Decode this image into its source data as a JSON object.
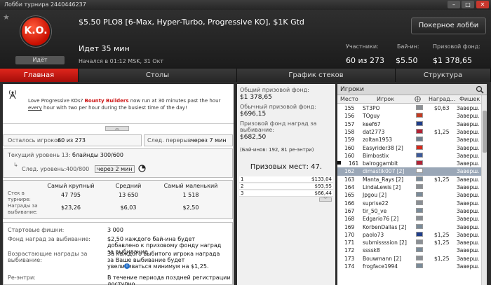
{
  "window": {
    "title": "Лобби турнира 2440446237"
  },
  "header": {
    "logo_text": "K.O.",
    "status": "Идёт",
    "tournament_name": "$5.50 PLO8 [6-Max, Hyper-Turbo, Progressive KO], $1K Gtd",
    "elapsed": "Идет 35 мин",
    "started": "Начался в 01:12 MSK, 31 Окт",
    "lobby_button": "Покерное лобби",
    "stats": [
      {
        "label": "Участники:",
        "value": "60 из 273"
      },
      {
        "label": "Бай-ин:",
        "value": "$5.50"
      },
      {
        "label": "Призовой фонд:",
        "value": "$1 378,65"
      }
    ]
  },
  "tabs": [
    "Главная",
    "Столы",
    "График стеков",
    "Структура"
  ],
  "promo": {
    "text_before": "Love Progressive KOs? ",
    "highlight": "Bounty Builders",
    "text_mid": " now run at 30 minutes past the hour ",
    "underline": "every",
    "text_after": " hour with two per hour during the busiest time of the day!"
  },
  "info": {
    "remaining_label": "Осталось игроков:",
    "remaining_value": "60 из 273",
    "break_label": "След. перерыв:",
    "break_value": "через 7 мин",
    "level_label": "Текущий уровень 13:",
    "level_value": "блайнды 300/600",
    "next_label": "След. уровень:",
    "next_value": "400/800",
    "next_time": "через 2 мин"
  },
  "stack_table": {
    "headers": [
      "Самый крупный",
      "Средний",
      "Самый маленький"
    ],
    "rows": [
      {
        "label": "Стек в турнире:",
        "values": [
          "47 795",
          "13 650",
          "1 518"
        ]
      },
      {
        "label": "Награды за выбивание:",
        "values": [
          "$23,26",
          "$6,03",
          "$2,50"
        ]
      }
    ]
  },
  "details": [
    {
      "label": "Стартовые фишки:",
      "value": "3 000"
    },
    {
      "label": "Фонд наград за выбивание:",
      "value": "$2,50 каждого бай-ина будет добавлено к призовому фонду наград за выбивание."
    },
    {
      "label": "Возрастающие награды за выбивание:",
      "value": "За каждого выбитого игрока награда за Ваше выбивание будет увеличиваться минимум на $1,25."
    },
    {
      "label": "Ре-энтри:",
      "value": "В течение периода поздней регистрации доступно"
    }
  ],
  "prize": {
    "total_label": "Общий призовой фонд:",
    "total_value": "$1 378,65",
    "regular_label": "Обычный призовой фонд:",
    "regular_value": "$696,15",
    "ko_label": "Призовой фонд наград за выбивание:",
    "ko_value": "$682,50",
    "buyins": "(Бай-инов: 192, 81 ре-энтри)",
    "places": "Призовых мест: 47.",
    "payouts": [
      {
        "place": "1",
        "amount": "$133,04"
      },
      {
        "place": "2",
        "amount": "$93,95"
      },
      {
        "place": "3",
        "amount": "$66,44"
      }
    ]
  },
  "players": {
    "title": "Игроки",
    "columns": [
      "Место",
      "Игрок",
      "Наград...",
      "Фишек"
    ],
    "rows": [
      {
        "place": "155",
        "name": "ST3PO",
        "bounty": "$0,63",
        "chips": "Заверш.",
        "flag": "#8a8f94"
      },
      {
        "place": "156",
        "name": "TOguy",
        "bounty": "",
        "chips": "Заверш.",
        "flag": "#c23b22"
      },
      {
        "place": "157",
        "name": "keef67",
        "bounty": "",
        "chips": "Заверш.",
        "flag": "#1f3e8a"
      },
      {
        "place": "158",
        "name": "dat2773",
        "bounty": "$1,25",
        "chips": "Заверш.",
        "flag": "#b22234"
      },
      {
        "place": "159",
        "name": "zoltan1953",
        "bounty": "",
        "chips": "Заверш.",
        "flag": "#6f7f8e"
      },
      {
        "place": "160",
        "name": "Easyrider38 [2]",
        "bounty": "",
        "chips": "Заверш.",
        "flag": "#d52b1e"
      },
      {
        "place": "160",
        "name": "Bimbostix",
        "bounty": "",
        "chips": "Заверш.",
        "flag": "#3c5a99"
      },
      {
        "place": "161",
        "name": "balroggambit",
        "bounty": "",
        "chips": "Заверш.",
        "flag": "#b22234"
      },
      {
        "place": "162",
        "name": "dimastik007 [2]",
        "bounty": "",
        "chips": "Заверш.",
        "flag": "#ffffff"
      },
      {
        "place": "163",
        "name": "Manta_Rays [2]",
        "bounty": "$1,25",
        "chips": "Заверш.",
        "flag": "#7a8b99"
      },
      {
        "place": "164",
        "name": "LindaLewis [2]",
        "bounty": "",
        "chips": "Заверш.",
        "flag": "#8a8f94"
      },
      {
        "place": "165",
        "name": "Jpgou [2]",
        "bounty": "",
        "chips": "Заверш.",
        "flag": "#7a8b99"
      },
      {
        "place": "166",
        "name": "suprise22",
        "bounty": "",
        "chips": "Заверш.",
        "flag": "#8a8f94"
      },
      {
        "place": "167",
        "name": "tir_50_ve",
        "bounty": "",
        "chips": "Заверш.",
        "flag": "#7a8b99"
      },
      {
        "place": "168",
        "name": "Edgario76 [2]",
        "bounty": "",
        "chips": "Заверш.",
        "flag": "#8a8f94"
      },
      {
        "place": "169",
        "name": "KorbenDallas [2]",
        "bounty": "",
        "chips": "Заверш.",
        "flag": "#7a8b99"
      },
      {
        "place": "170",
        "name": "paolo73",
        "bounty": "$1,25",
        "chips": "Заверш.",
        "flag": "#1f3e8a"
      },
      {
        "place": "171",
        "name": "submissssion [2]",
        "bounty": "$1,25",
        "chips": "Заверш.",
        "flag": "#8a8f94"
      },
      {
        "place": "172",
        "name": "ssssk8",
        "bounty": "",
        "chips": "Заверш.",
        "flag": "#7a8b99"
      },
      {
        "place": "173",
        "name": "Bouwmann [2]",
        "bounty": "$1,25",
        "chips": "Заверш.",
        "flag": "#8a8f94"
      },
      {
        "place": "174",
        "name": "frogface1994",
        "bounty": "",
        "chips": "Заверш.",
        "flag": "#7a8b99"
      }
    ]
  },
  "colors": {
    "accent": "#d21f16",
    "selected_row": "#9aa7b7"
  }
}
